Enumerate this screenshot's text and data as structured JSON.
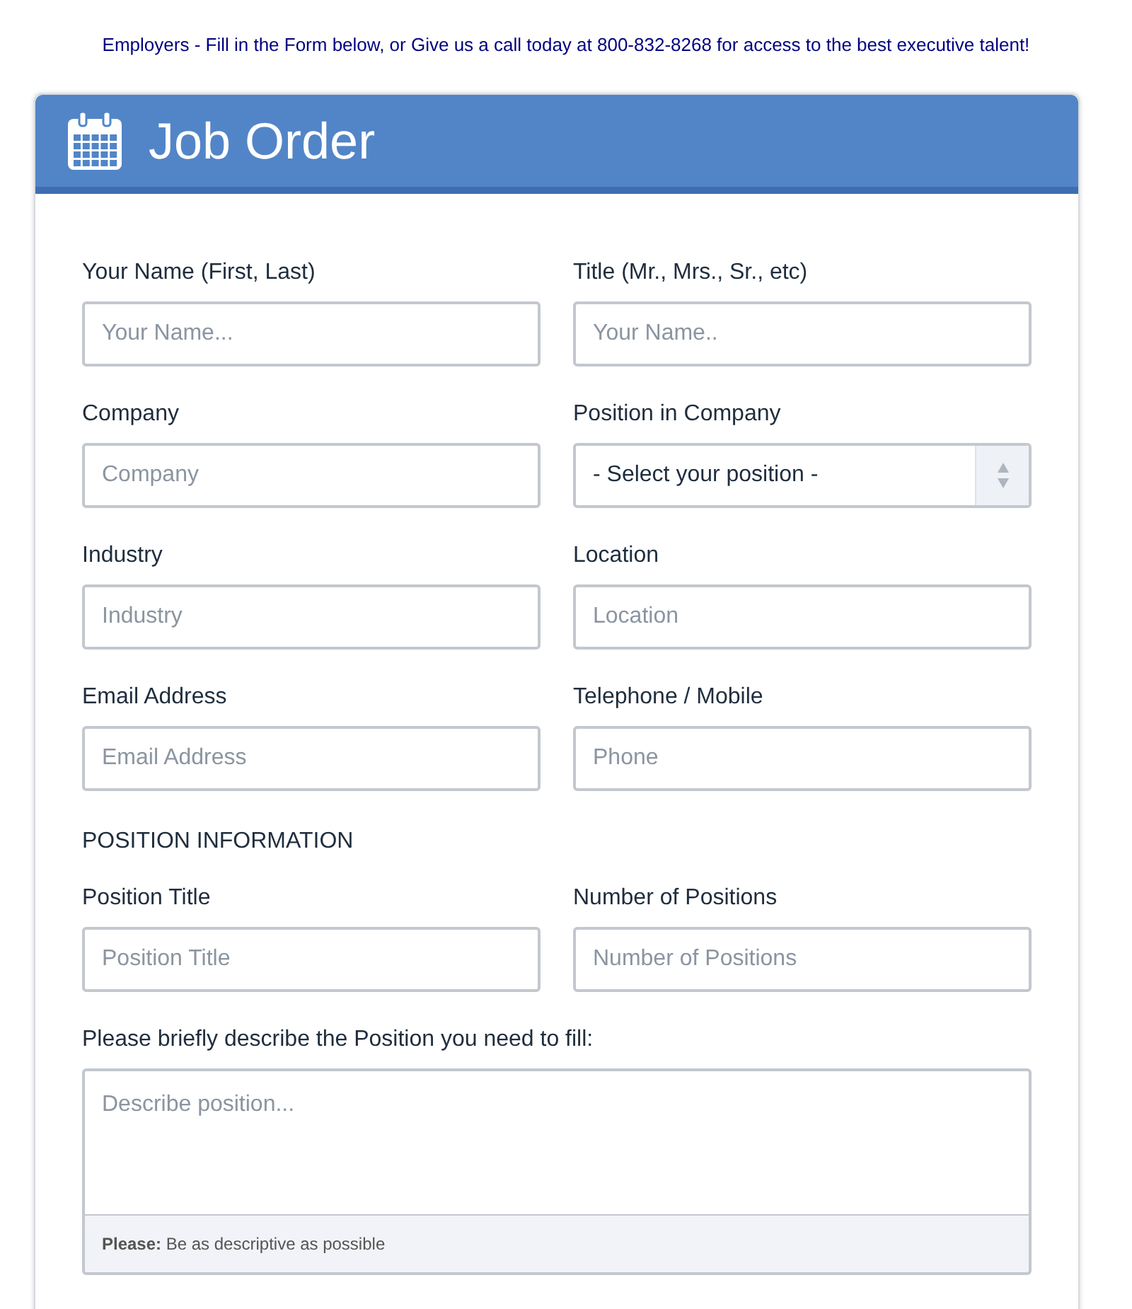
{
  "intro": "Employers - Fill in the Form below, or Give us a call today at 800-832-8268 for access to the best executive talent!",
  "header": {
    "title": "Job Order"
  },
  "contact_fields": [
    {
      "kind": "text",
      "label": "Your Name (First, Last)",
      "placeholder": "Your Name..."
    },
    {
      "kind": "text",
      "label": "Title (Mr., Mrs., Sr., etc)",
      "placeholder": "Your Name.."
    },
    {
      "kind": "text",
      "label": "Company",
      "placeholder": "Company"
    },
    {
      "kind": "select",
      "label": "Position in Company",
      "value": "- Select your position -"
    },
    {
      "kind": "text",
      "label": "Industry",
      "placeholder": "Industry"
    },
    {
      "kind": "text",
      "label": "Location",
      "placeholder": "Location"
    },
    {
      "kind": "text",
      "label": "Email Address",
      "placeholder": "Email Address"
    },
    {
      "kind": "text",
      "label": "Telephone / Mobile",
      "placeholder": "Phone"
    }
  ],
  "section_heading": "POSITION INFORMATION",
  "position_fields": [
    {
      "kind": "text",
      "label": "Position Title",
      "placeholder": "Position Title"
    },
    {
      "kind": "text",
      "label": "Number of Positions",
      "placeholder": "Number of Positions"
    }
  ],
  "description": {
    "label": "Please briefly describe the Position you need to fill:",
    "placeholder": "Describe position...",
    "note": "**Please:** Be as descriptive as possible"
  }
}
